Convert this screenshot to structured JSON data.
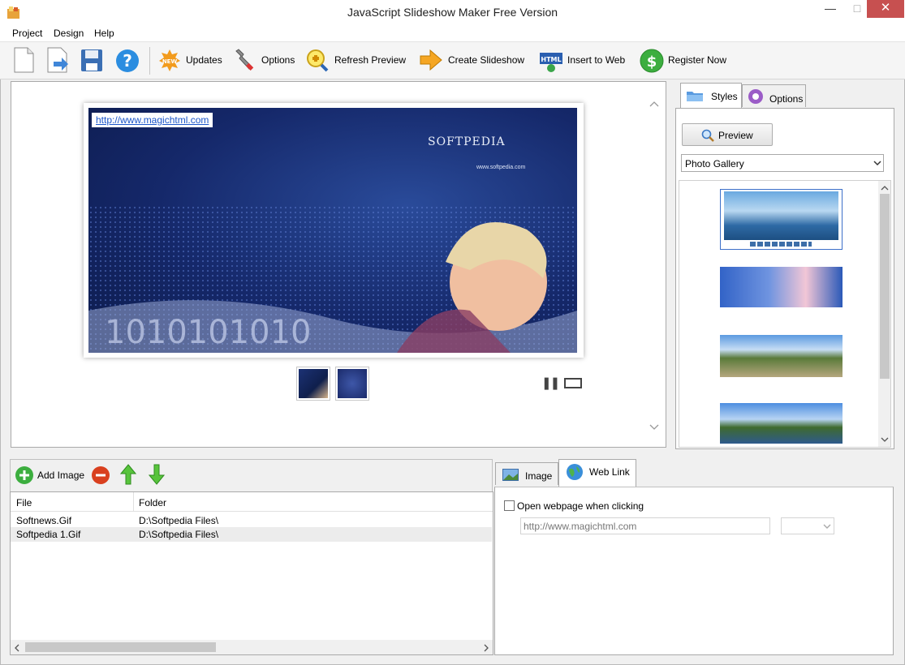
{
  "window": {
    "title": "JavaScript Slideshow Maker Free Version",
    "min_glyph": "—",
    "max_glyph": "□",
    "close_glyph": "✕"
  },
  "menu": {
    "items": [
      "Project",
      "Design",
      "Help"
    ]
  },
  "toolbar": {
    "updates": "Updates",
    "options": "Options",
    "refresh_preview": "Refresh Preview",
    "create_slideshow": "Create Slideshow",
    "insert_to_web": "Insert to Web",
    "register_now": "Register Now",
    "new_badge": "NEW",
    "html_badge": "HTML"
  },
  "preview": {
    "link_text": "http://www.magichtml.com",
    "watermark_title": "SOFTPEDIA",
    "watermark_url": "www.softpedia.com",
    "pause_glyph": "❚❚"
  },
  "styles_panel": {
    "tab_styles": "Styles",
    "tab_options": "Options",
    "preview_button": "Preview",
    "style_select_value": "Photo Gallery"
  },
  "images_panel": {
    "add_image": "Add Image",
    "columns": [
      "File",
      "Folder"
    ],
    "rows": [
      {
        "file": "Softnews.Gif",
        "folder": "D:\\Softpedia Files\\"
      },
      {
        "file": "Softpedia 1.Gif",
        "folder": "D:\\Softpedia Files\\"
      }
    ]
  },
  "props_panel": {
    "tab_image": "Image",
    "tab_weblink": "Web Link",
    "open_webpage_label": "Open webpage when clicking",
    "url_value": "http://www.magichtml.com"
  },
  "colors": {
    "accent_blue": "#2a7ae2",
    "close_red": "#c75050",
    "preview_bg": "#1a2e66"
  }
}
